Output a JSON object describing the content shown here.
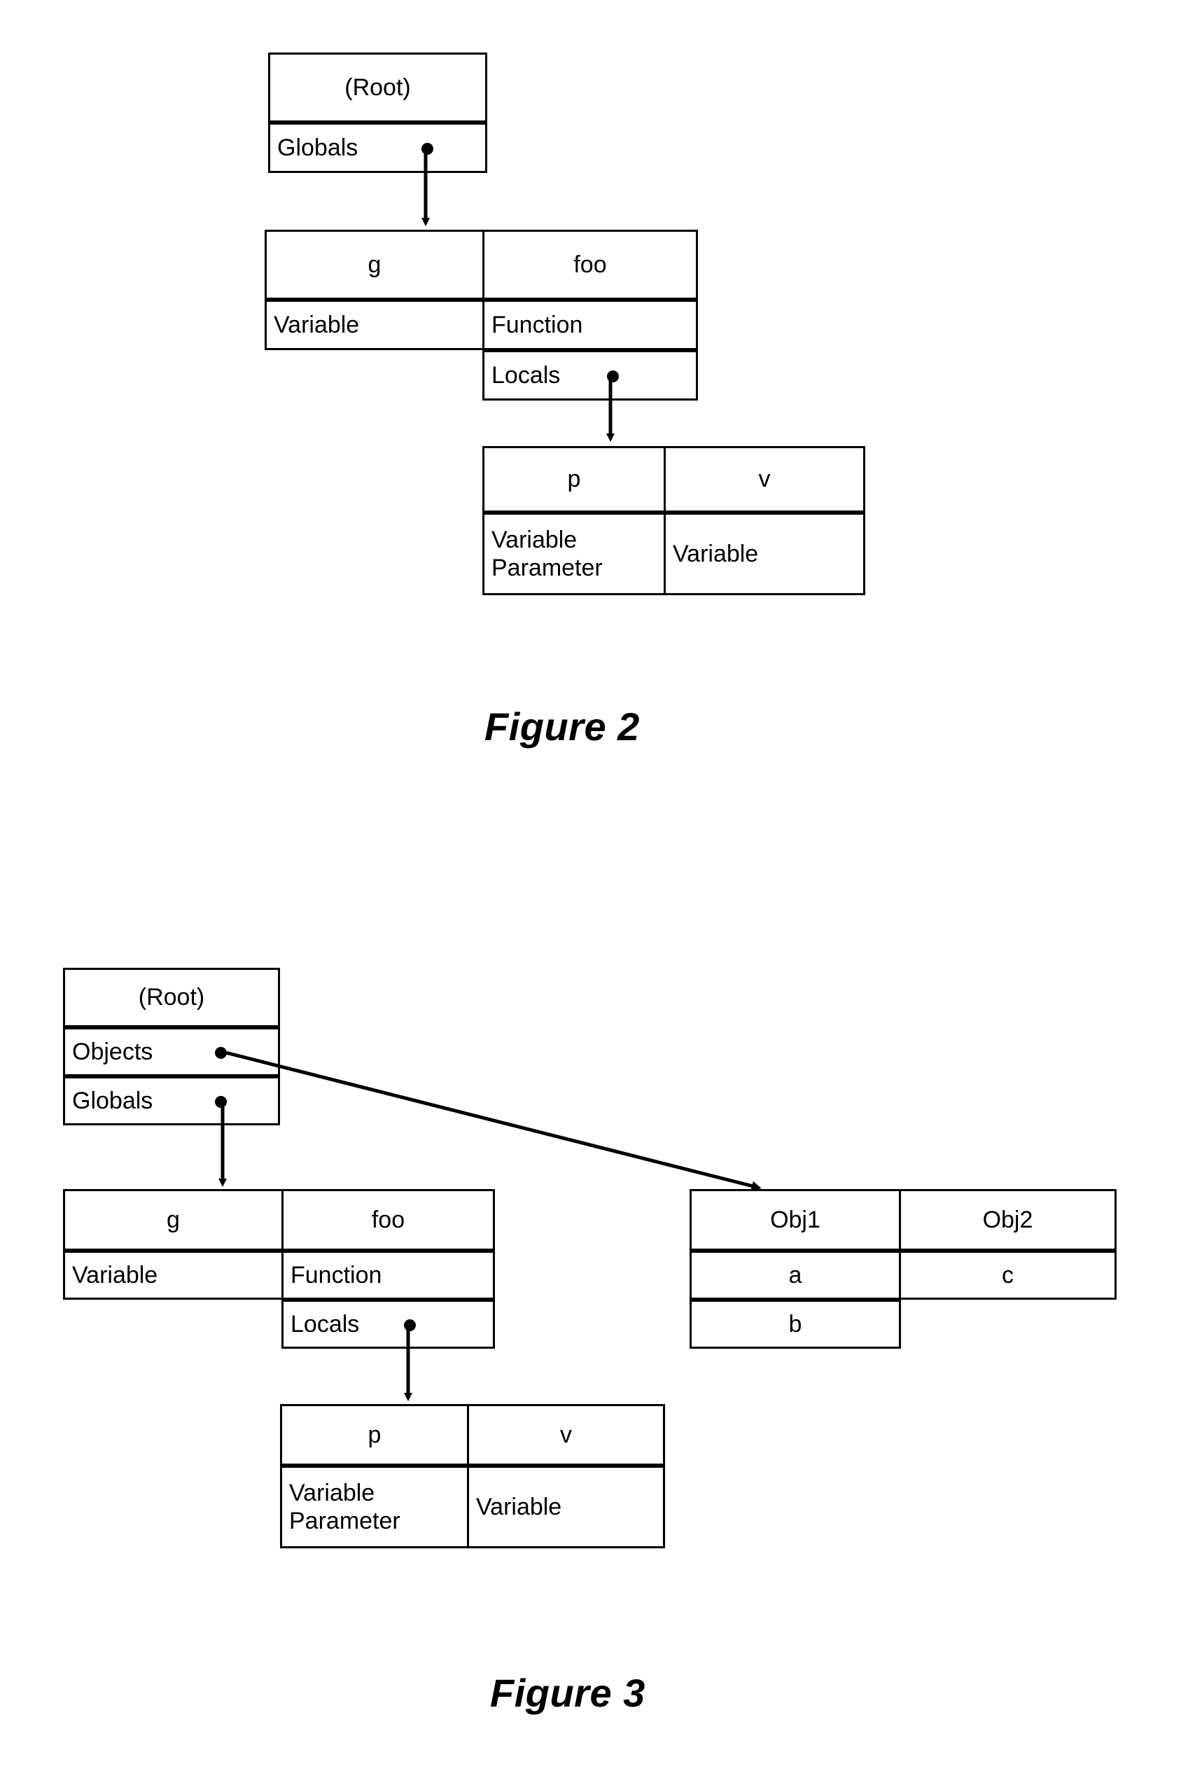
{
  "document": {
    "kind": "patent-drawing-sheet",
    "background_color": "#ffffff",
    "line_color": "#000000"
  },
  "figure2": {
    "caption": "Figure 2",
    "root_node": {
      "title": "(Root)",
      "slots": [
        {
          "label": "Globals",
          "has_pointer": true
        }
      ]
    },
    "globals_table": {
      "columns": [
        {
          "name": "g",
          "rows": [
            {
              "label": "Variable",
              "has_pointer": false
            }
          ]
        },
        {
          "name": "foo",
          "rows": [
            {
              "label": "Function",
              "has_pointer": false
            },
            {
              "label": "Locals",
              "has_pointer": true
            }
          ]
        }
      ]
    },
    "locals_table": {
      "columns": [
        {
          "name": "p",
          "rows": [
            {
              "label": "Variable\nParameter",
              "has_pointer": false
            }
          ]
        },
        {
          "name": "v",
          "rows": [
            {
              "label": "Variable",
              "has_pointer": false
            }
          ]
        }
      ]
    },
    "edges": [
      {
        "from": "root.Globals",
        "to": "globals_table",
        "style": "straight-down-arrow"
      },
      {
        "from": "foo.Locals",
        "to": "locals_table",
        "style": "straight-down-arrow"
      }
    ]
  },
  "figure3": {
    "caption": "Figure 3",
    "root_node": {
      "title": "(Root)",
      "slots": [
        {
          "label": "Objects",
          "has_pointer": true
        },
        {
          "label": "Globals",
          "has_pointer": true
        }
      ]
    },
    "globals_table": {
      "columns": [
        {
          "name": "g",
          "rows": [
            {
              "label": "Variable",
              "has_pointer": false
            }
          ]
        },
        {
          "name": "foo",
          "rows": [
            {
              "label": "Function",
              "has_pointer": false
            },
            {
              "label": "Locals",
              "has_pointer": true
            }
          ]
        }
      ]
    },
    "locals_table": {
      "columns": [
        {
          "name": "p",
          "rows": [
            {
              "label": "Variable\nParameter",
              "has_pointer": false
            }
          ]
        },
        {
          "name": "v",
          "rows": [
            {
              "label": "Variable",
              "has_pointer": false
            }
          ]
        }
      ]
    },
    "objects_table": {
      "columns": [
        {
          "name": "Obj1",
          "rows": [
            {
              "label": "a",
              "has_pointer": false
            },
            {
              "label": "b",
              "has_pointer": false
            }
          ]
        },
        {
          "name": "Obj2",
          "rows": [
            {
              "label": "c",
              "has_pointer": false
            }
          ]
        }
      ]
    },
    "edges": [
      {
        "from": "root.Objects",
        "to": "objects_table",
        "style": "diagonal-arrow"
      },
      {
        "from": "root.Globals",
        "to": "globals_table",
        "style": "straight-down-arrow"
      },
      {
        "from": "foo.Locals",
        "to": "locals_table",
        "style": "straight-down-arrow"
      }
    ]
  }
}
